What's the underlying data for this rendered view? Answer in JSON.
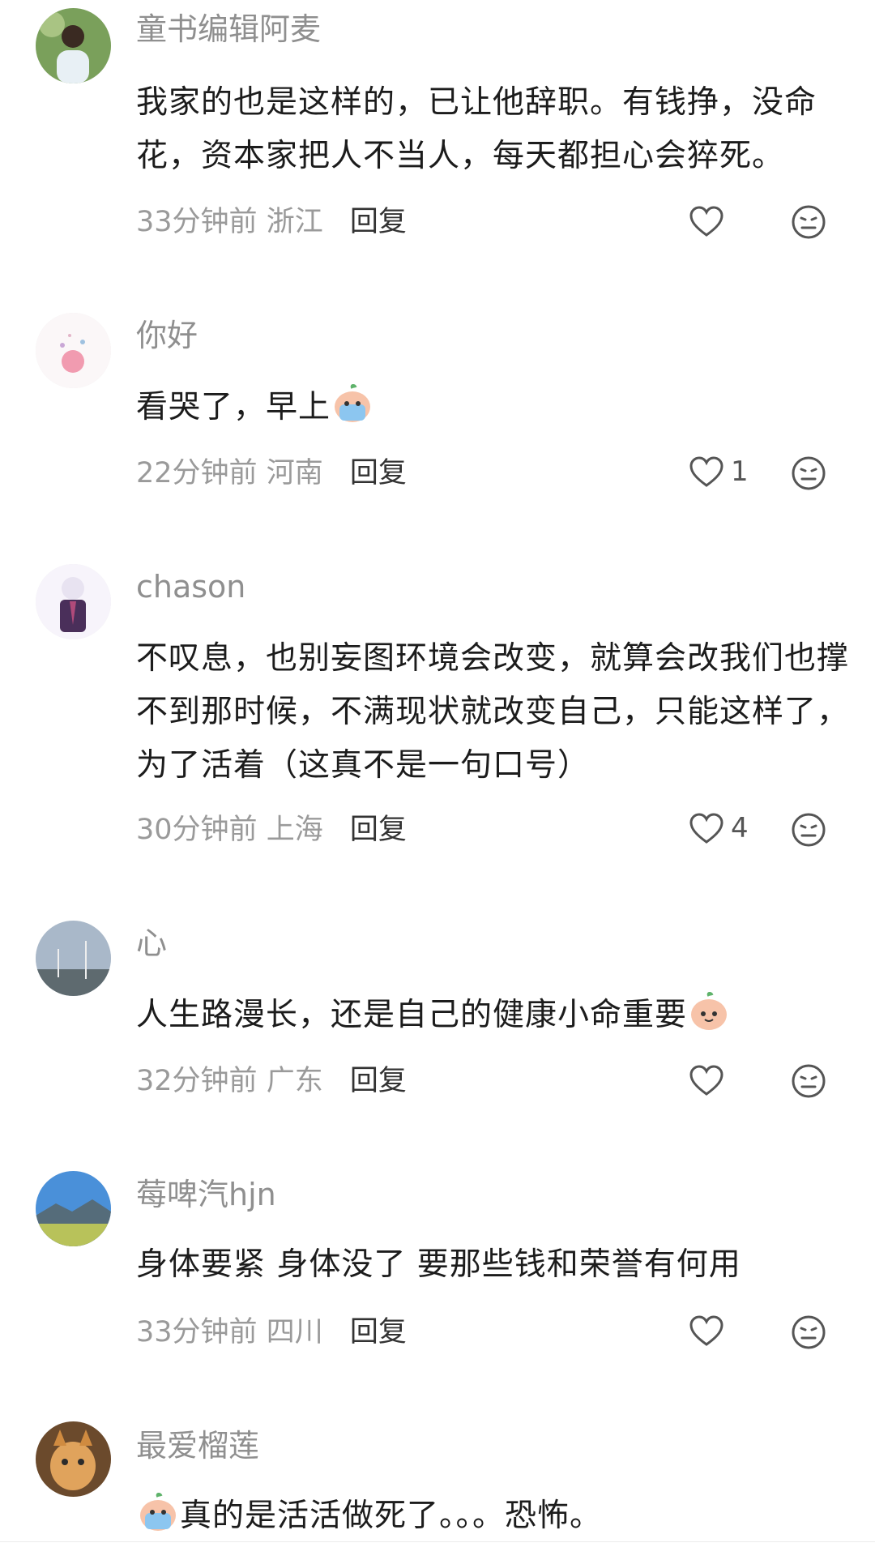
{
  "comments": [
    {
      "username": "童书编辑阿麦",
      "text": "我家的也是这样的，已让他辞职。有钱挣，没命花，资本家把人不当人，每天都担心会猝死。",
      "time": "33分钟前",
      "location": "浙江",
      "reply": "回复",
      "likes": ""
    },
    {
      "username": "你好",
      "text": "看哭了，早上",
      "time": "22分钟前",
      "location": "河南",
      "reply": "回复",
      "likes": "1"
    },
    {
      "username": "chason",
      "text": "不叹息，也别妄图环境会改变，就算会改我们也撑不到那时候，不满现状就改变自己，只能这样了，为了活着（这真不是一句口号）",
      "time": "30分钟前",
      "location": "上海",
      "reply": "回复",
      "likes": "4"
    },
    {
      "username": "心",
      "text": "人生路漫长，还是自己的健康小命重要",
      "time": "32分钟前",
      "location": "广东",
      "reply": "回复",
      "likes": ""
    },
    {
      "username": "莓啤汽hjn",
      "text": "身体要紧 身体没了 要那些钱和荣誉有何用",
      "time": "33分钟前",
      "location": "四川",
      "reply": "回复",
      "likes": ""
    },
    {
      "username": "最爱榴莲",
      "text": "真的是活活做死了。。。恐怖。",
      "time": "",
      "location": "",
      "reply": "",
      "likes": ""
    }
  ],
  "icons": {
    "like": "heart-outline-icon",
    "more": "neutral-face-icon",
    "emoji_cry": "crying-peach-emoji",
    "emoji_smile": "smiling-peach-emoji"
  }
}
